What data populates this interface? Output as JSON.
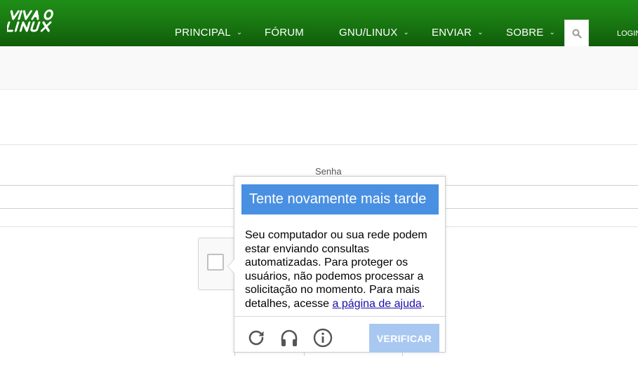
{
  "header": {
    "logo_text": "VIVA O LINUX",
    "nav": [
      {
        "label": "PRINCIPAL",
        "has_dropdown": true
      },
      {
        "label": "FÓRUM",
        "has_dropdown": false
      },
      {
        "label": "GNU/LINUX",
        "has_dropdown": true
      },
      {
        "label": "ENVIAR",
        "has_dropdown": true
      },
      {
        "label": "SOBRE",
        "has_dropdown": true
      }
    ],
    "search_icon": "search-icon",
    "login_label": "LOGIN"
  },
  "form": {
    "password_label": "Senha"
  },
  "challenge": {
    "title": "Tente novamente mais tarde",
    "message_before_link": "Seu computador ou sua rede podem estar enviando consultas automatizadas. Para proteger os usuários, não podemos processar a solicitação no momento. Para mais detalhes, acesse ",
    "link_text": "a página de ajuda",
    "message_after_link": ".",
    "icons": [
      "reload-icon",
      "headphones-icon",
      "info-icon"
    ],
    "verify_label": "VERIFICAR"
  },
  "colors": {
    "header_green": "#1a7a12",
    "challenge_blue": "#4a90e2",
    "verify_disabled": "#a8c8f2"
  }
}
